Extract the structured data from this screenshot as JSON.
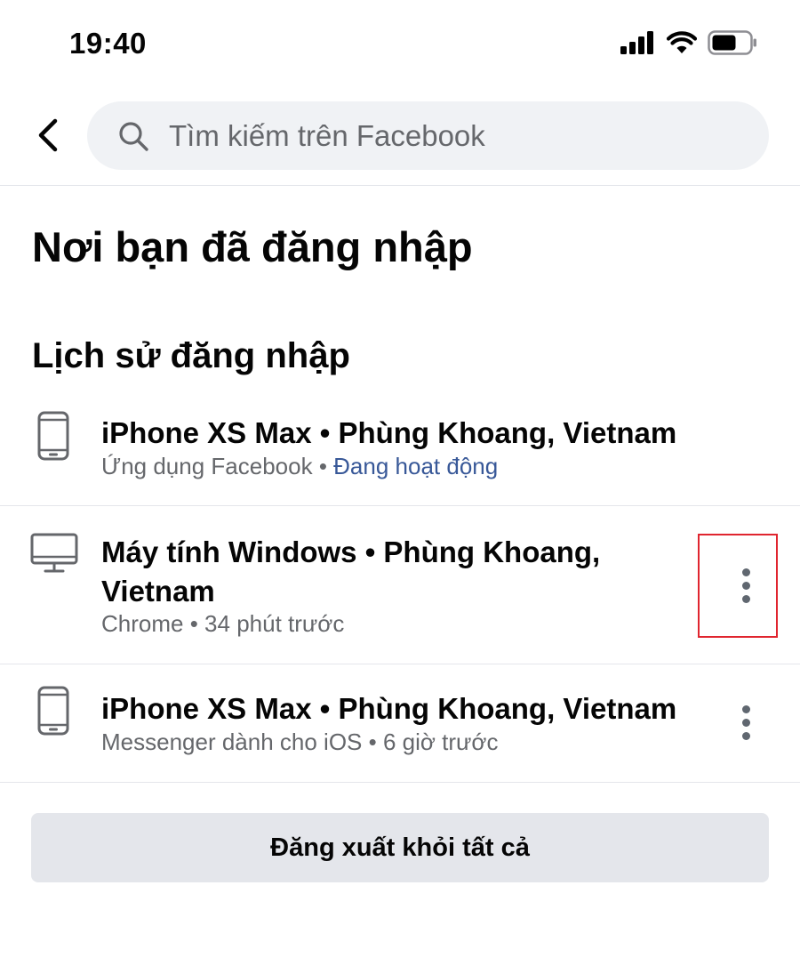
{
  "status_bar": {
    "time": "19:40",
    "icons": [
      "signal-icon",
      "wifi-icon",
      "battery-icon"
    ]
  },
  "nav": {
    "back_icon": "chevron-left-icon",
    "search_icon": "search-icon",
    "search_placeholder": "Tìm kiếm trên Facebook"
  },
  "page": {
    "title": "Nơi bạn đã đăng nhập",
    "section_title": "Lịch sử đăng nhập"
  },
  "sessions": [
    {
      "device_icon": "phone-icon",
      "title": "iPhone XS Max • Phùng Khoang, Vietnam",
      "app": "Ứng dụng Facebook",
      "separator": " • ",
      "status": "Đang hoạt động",
      "has_menu": false
    },
    {
      "device_icon": "desktop-icon",
      "title": "Máy tính Windows • Phùng Khoang, Vietnam",
      "app": "Chrome",
      "separator": " • ",
      "status": "34 phút trước",
      "has_menu": true
    },
    {
      "device_icon": "phone-icon",
      "title": "iPhone XS Max • Phùng Khoang, Vietnam",
      "app": "Messenger dành cho iOS",
      "separator": " • ",
      "status": "6 giờ trước",
      "has_menu": true
    }
  ],
  "actions": {
    "logout_all_label": "Đăng xuất khỏi tất cả"
  },
  "colors": {
    "active_status": "#385898",
    "highlight_border": "#e0252f",
    "search_bg": "#f0f2f5",
    "button_bg": "#e4e6eb"
  }
}
